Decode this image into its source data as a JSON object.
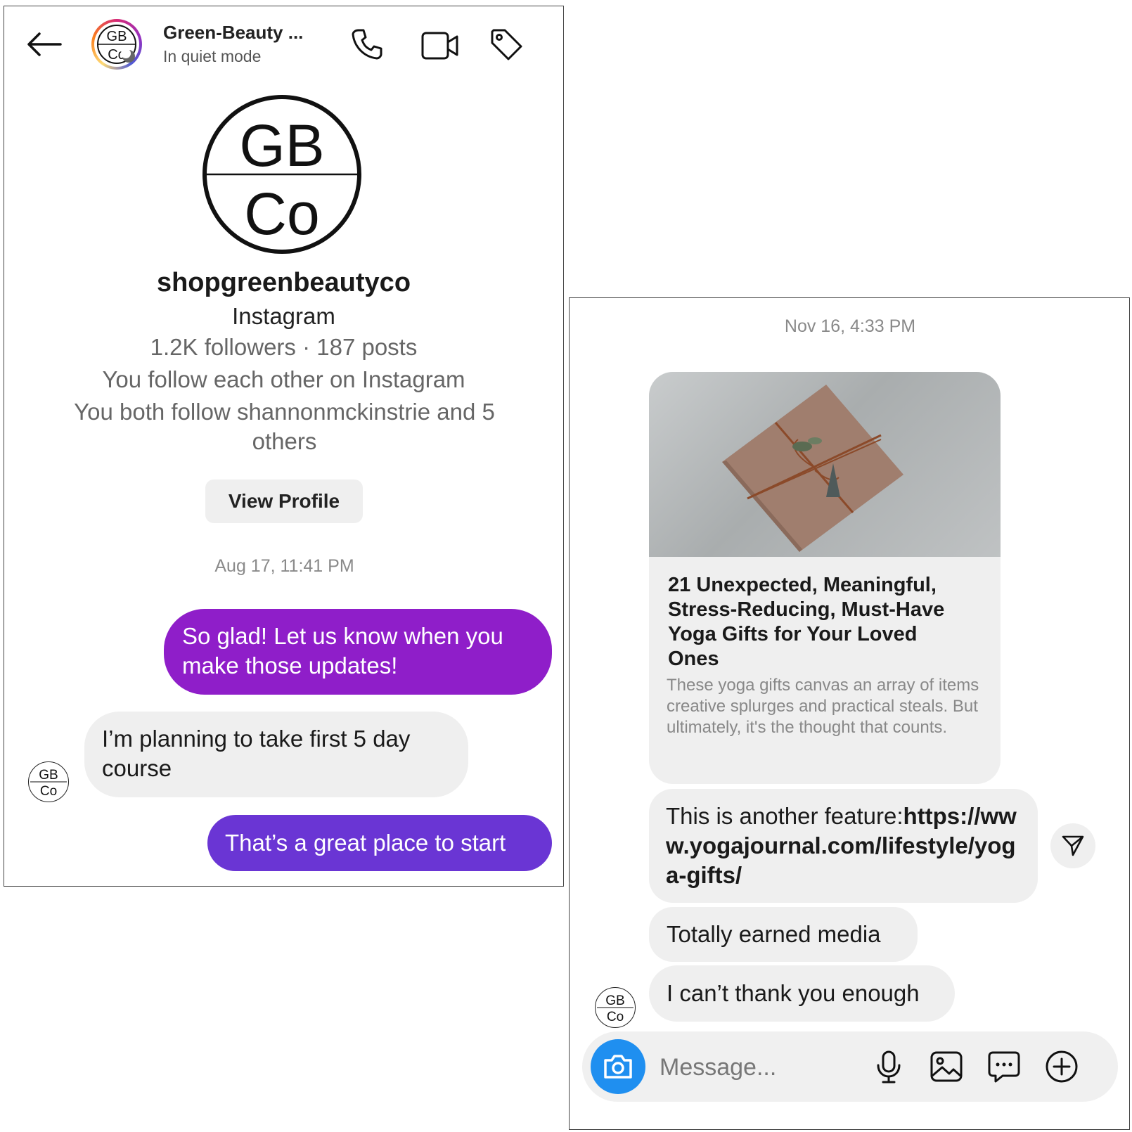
{
  "header": {
    "title": "Green-Beauty ...",
    "subtitle": "In quiet mode",
    "icons": [
      "back-arrow-icon",
      "phone-icon",
      "video-camera-icon",
      "tag-icon"
    ]
  },
  "profile": {
    "logo_top": "GB",
    "logo_bottom": "Co",
    "username": "shopgreenbeautyco",
    "platform": "Instagram",
    "stats": "1.2K followers · 187 posts",
    "mutual_follow": "You follow each other on Instagram",
    "mutual_friends": "You both follow shannonmckinstrie and 5 others",
    "view_profile_label": "View Profile"
  },
  "thread_left": {
    "timestamp": "Aug 17, 11:41 PM",
    "messages": [
      {
        "from": "me",
        "text": "So glad! Let us know when you make those updates!"
      },
      {
        "from": "them",
        "text": "I’m planning to take first 5 day course"
      },
      {
        "from": "me",
        "text": "That’s a great place to start"
      }
    ]
  },
  "thread_right": {
    "timestamp": "Nov 16, 4:33 PM",
    "link_card": {
      "title": "21 Unexpected, Meaningful, Stress-Reducing, Must-Have Yoga Gifts for Your Loved Ones",
      "description": "These yoga gifts canvas an array of items creative splurges and practical steals. But ultimately, it's the thought that counts."
    },
    "messages": [
      {
        "from": "them",
        "text_plain": "This is another feature:",
        "text_link": "https://www.yogajournal.com/lifestyle/yoga-gifts/"
      },
      {
        "from": "them",
        "text": "Totally earned media"
      },
      {
        "from": "them",
        "text": "I can’t thank you enough"
      }
    ]
  },
  "composer": {
    "placeholder": "Message...",
    "icons": [
      "camera-icon",
      "microphone-icon",
      "image-icon",
      "sticker-chat-icon",
      "plus-icon"
    ]
  },
  "colors": {
    "bubble_purple": "#8f1ec9",
    "bubble_violet": "#6a35d4",
    "bubble_gray": "#efefef",
    "camera_blue": "#1f8ff0"
  }
}
